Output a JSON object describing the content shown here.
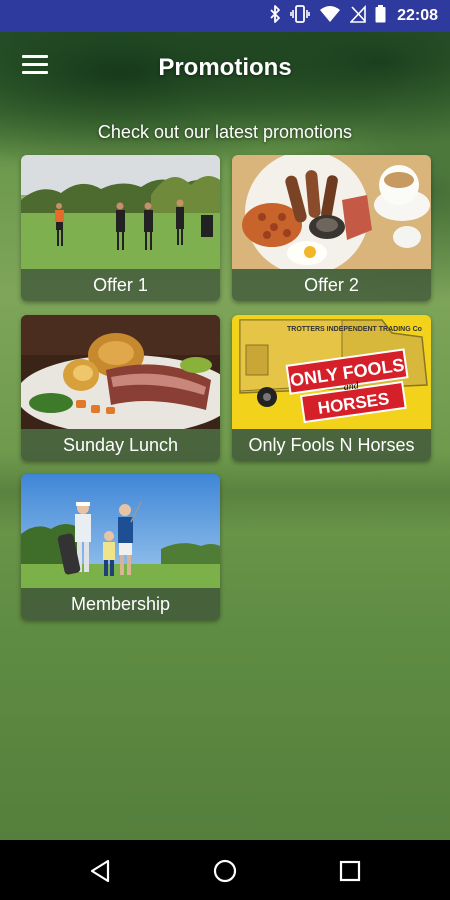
{
  "status_bar": {
    "time": "22:08",
    "icons": [
      "bluetooth-icon",
      "vibrate-icon",
      "wifi-icon",
      "no-signal-icon",
      "battery-icon"
    ]
  },
  "app_bar": {
    "title": "Promotions",
    "menu_icon": "hamburger-menu-icon"
  },
  "subtitle": "Check out our latest promotions",
  "promotions": [
    {
      "label": "Offer 1"
    },
    {
      "label": "Offer 2"
    },
    {
      "label": "Sunday Lunch"
    },
    {
      "label": "Only Fools N Horses"
    },
    {
      "label": "Membership"
    }
  ],
  "only_fools_logo": {
    "line1": "ONLY FOOLS",
    "line2": "and",
    "line3": "HORSES",
    "van_text": "TROTTERS INDEPENDENT TRADING Co"
  },
  "nav_bar": {
    "icons": [
      "back-icon",
      "home-icon",
      "recents-icon"
    ]
  },
  "colors": {
    "status_bar": "#2f3a9e",
    "label_overlay": "#3c5037",
    "fools_yellow": "#f2d21a",
    "fools_red": "#d52029"
  }
}
